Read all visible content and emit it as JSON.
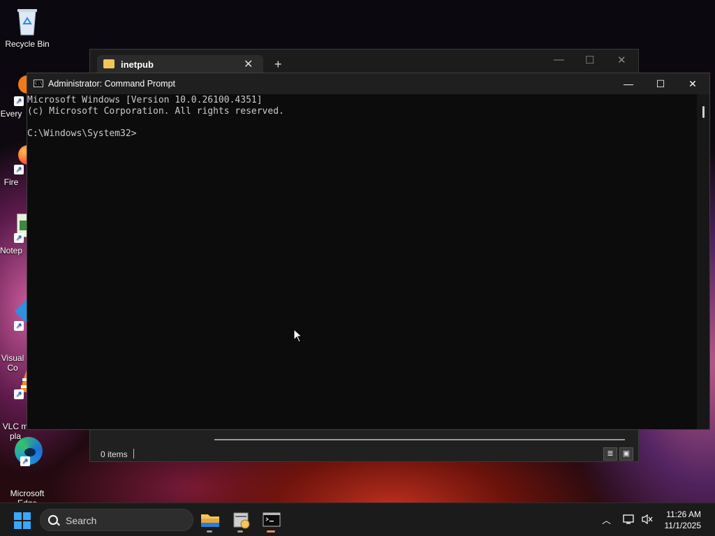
{
  "desktop": {
    "icons": [
      {
        "label": "Recycle Bin"
      },
      {
        "label": "Every"
      },
      {
        "label": "Fire"
      },
      {
        "label": "Notep"
      },
      {
        "label": "Visual\nCo"
      },
      {
        "label": "VLC m\npla"
      },
      {
        "label": "Microsoft\nEdge"
      }
    ]
  },
  "explorer": {
    "tab_label": "inetpub",
    "tab_close": "✕",
    "tab_add": "+",
    "status_text": "0 items"
  },
  "cmd": {
    "icon_text": "C:\\",
    "title": "Administrator: Command Prompt",
    "lines": [
      "Microsoft Windows [Version 10.0.26100.4351]",
      "(c) Microsoft Corporation. All rights reserved.",
      "",
      "C:\\Windows\\System32>"
    ]
  },
  "taskbar": {
    "search_label": "Search",
    "time": "11:26 AM",
    "date": "11/1/2025"
  },
  "colors": {
    "accent": "#3aa7ff",
    "cmd_background": "#0c0c0c",
    "cmd_text": "#cccccc",
    "folder": "#f2c55c",
    "active_indicator": "#f28b5b"
  }
}
